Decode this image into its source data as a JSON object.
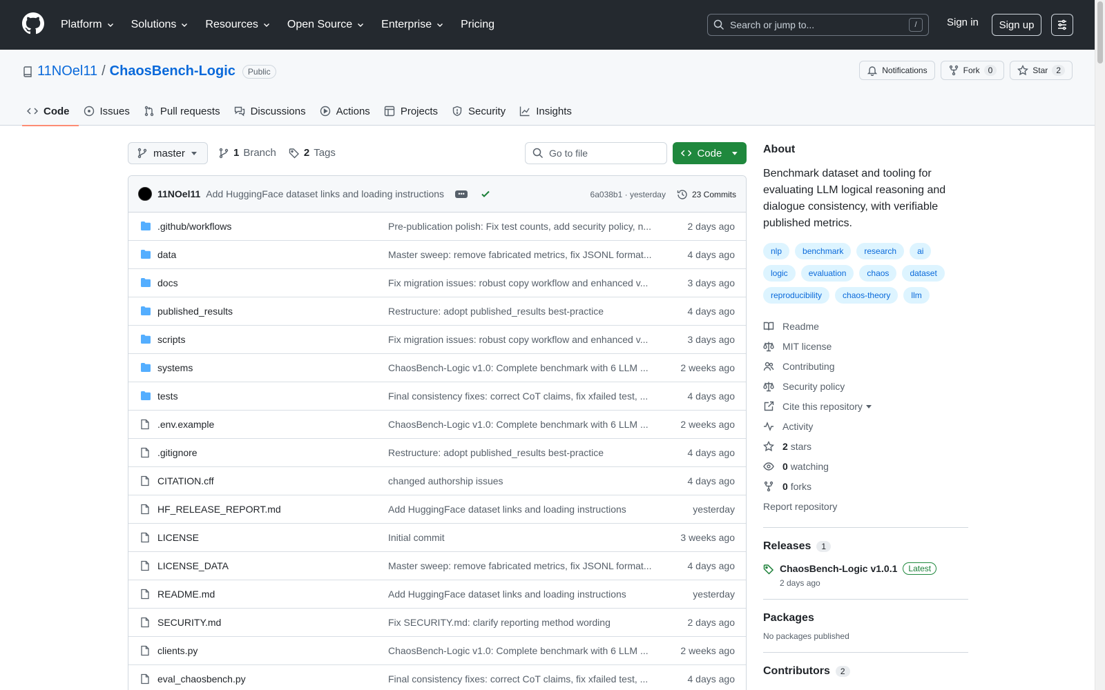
{
  "header": {
    "nav": [
      "Platform",
      "Solutions",
      "Resources",
      "Open Source",
      "Enterprise",
      "Pricing"
    ],
    "nav_has_chevron": [
      true,
      true,
      true,
      true,
      true,
      false
    ],
    "search_placeholder": "Search or jump to...",
    "search_shortcut": "/",
    "sign_in": "Sign in",
    "sign_up": "Sign up"
  },
  "repo": {
    "owner": "11NOel11",
    "separator": "/",
    "name": "ChaosBench-Logic",
    "visibility": "Public",
    "notifications_label": "Notifications",
    "fork_label": "Fork",
    "fork_count": "0",
    "star_label": "Star",
    "star_count": "2",
    "tabs": [
      "Code",
      "Issues",
      "Pull requests",
      "Discussions",
      "Actions",
      "Projects",
      "Security",
      "Insights"
    ]
  },
  "toolbar": {
    "branch": "master",
    "branch_count": "1",
    "branch_label": "Branch",
    "tag_count": "2",
    "tag_label": "Tags",
    "goto_placeholder": "Go to file",
    "code_label": "Code"
  },
  "commit": {
    "author": "11NOel11",
    "message": "Add HuggingFace dataset links and loading instructions",
    "hash": "6a038b1",
    "dot": "·",
    "time": "yesterday",
    "commits_label": "23 Commits"
  },
  "files": [
    {
      "name": ".github/workflows",
      "type": "dir",
      "message": "Pre-publication polish: Fix test counts, add security policy, n...",
      "age": "2 days ago"
    },
    {
      "name": "data",
      "type": "dir",
      "message": "Master sweep: remove fabricated metrics, fix JSONL format...",
      "age": "4 days ago"
    },
    {
      "name": "docs",
      "type": "dir",
      "message": "Fix migration issues: robust copy workflow and enhanced v...",
      "age": "3 days ago"
    },
    {
      "name": "published_results",
      "type": "dir",
      "message": "Restructure: adopt published_results best-practice",
      "age": "4 days ago"
    },
    {
      "name": "scripts",
      "type": "dir",
      "message": "Fix migration issues: robust copy workflow and enhanced v...",
      "age": "3 days ago"
    },
    {
      "name": "systems",
      "type": "dir",
      "message": "ChaosBench-Logic v1.0: Complete benchmark with 6 LLM ...",
      "age": "2 weeks ago"
    },
    {
      "name": "tests",
      "type": "dir",
      "message": "Final consistency fixes: correct CoT claims, fix xfailed test, ...",
      "age": "4 days ago"
    },
    {
      "name": ".env.example",
      "type": "file",
      "message": "ChaosBench-Logic v1.0: Complete benchmark with 6 LLM ...",
      "age": "2 weeks ago"
    },
    {
      "name": ".gitignore",
      "type": "file",
      "message": "Restructure: adopt published_results best-practice",
      "age": "4 days ago"
    },
    {
      "name": "CITATION.cff",
      "type": "file",
      "message": "changed authorship issues",
      "age": "4 days ago"
    },
    {
      "name": "HF_RELEASE_REPORT.md",
      "type": "file",
      "message": "Add HuggingFace dataset links and loading instructions",
      "age": "yesterday"
    },
    {
      "name": "LICENSE",
      "type": "file",
      "message": "Initial commit",
      "age": "3 weeks ago"
    },
    {
      "name": "LICENSE_DATA",
      "type": "file",
      "message": "Master sweep: remove fabricated metrics, fix JSONL format...",
      "age": "4 days ago"
    },
    {
      "name": "README.md",
      "type": "file",
      "message": "Add HuggingFace dataset links and loading instructions",
      "age": "yesterday"
    },
    {
      "name": "SECURITY.md",
      "type": "file",
      "message": "Fix SECURITY.md: clarify reporting method wording",
      "age": "2 days ago"
    },
    {
      "name": "clients.py",
      "type": "file",
      "message": "ChaosBench-Logic v1.0: Complete benchmark with 6 LLM ...",
      "age": "2 weeks ago"
    },
    {
      "name": "eval_chaosbench.py",
      "type": "file",
      "message": "Final consistency fixes: correct CoT claims, fix xfailed test, ...",
      "age": "4 days ago"
    }
  ],
  "about": {
    "title": "About",
    "description": "Benchmark dataset and tooling for evaluating LLM logical reasoning and dialogue consistency, with verifiable published metrics.",
    "topics": [
      "nlp",
      "benchmark",
      "research",
      "ai",
      "logic",
      "evaluation",
      "chaos",
      "dataset",
      "reproducibility",
      "chaos-theory",
      "llm"
    ],
    "links": [
      {
        "icon": "book-icon",
        "label": "Readme"
      },
      {
        "icon": "law-icon",
        "label": "MIT license"
      },
      {
        "icon": "people-icon",
        "label": "Contributing"
      },
      {
        "icon": "law-icon",
        "label": "Security policy"
      },
      {
        "icon": "cite-icon",
        "label": "Cite this repository"
      },
      {
        "icon": "pulse-icon",
        "label": "Activity"
      },
      {
        "icon": "star-icon",
        "bold": "2",
        "label": "stars"
      },
      {
        "icon": "eye-icon",
        "bold": "0",
        "label": "watching"
      },
      {
        "icon": "fork-icon",
        "bold": "0",
        "label": "forks"
      }
    ],
    "report": "Report repository"
  },
  "releases": {
    "title": "Releases",
    "count": "1",
    "name": "ChaosBench-Logic v1.0.1",
    "latest_label": "Latest",
    "date": "2 days ago"
  },
  "packages": {
    "title": "Packages",
    "empty": "No packages published"
  },
  "contributors": {
    "title": "Contributors",
    "count": "2"
  }
}
